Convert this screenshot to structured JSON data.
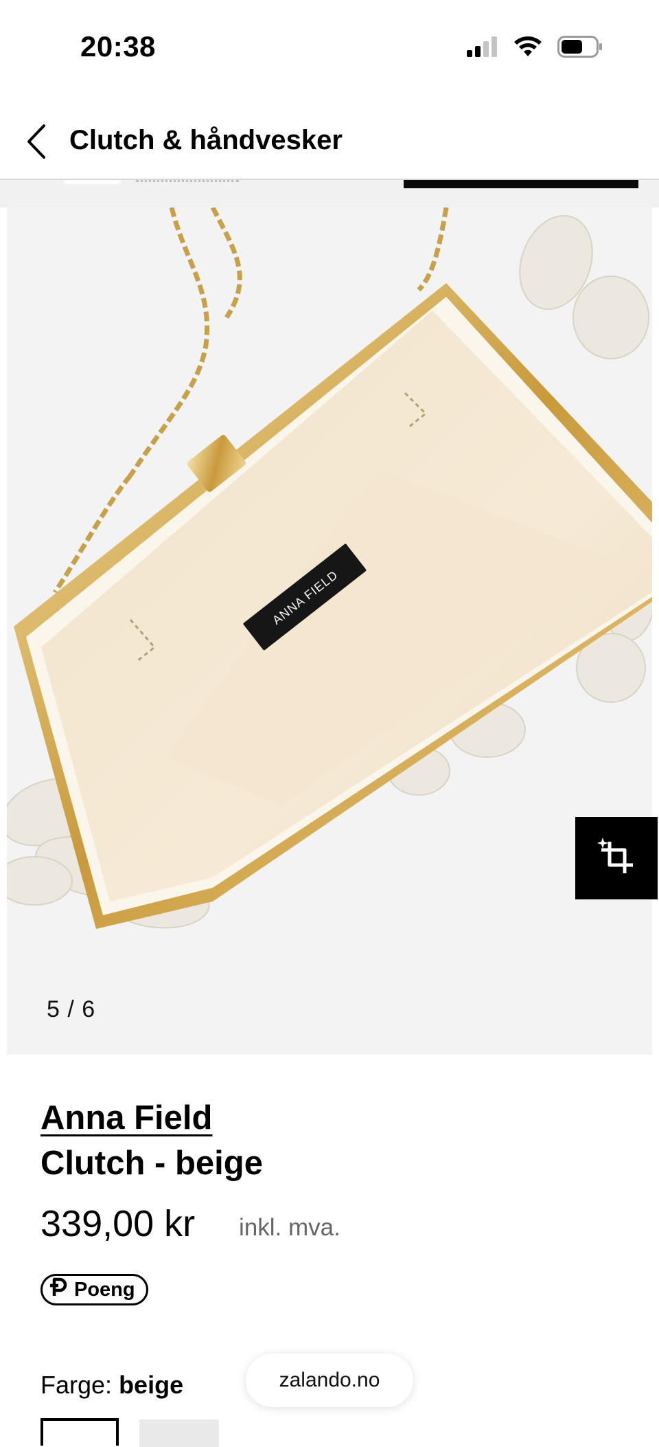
{
  "status_bar": {
    "time": "20:38",
    "icons": [
      "cellular-signal-icon",
      "wifi-icon",
      "battery-icon"
    ]
  },
  "header": {
    "back_icon": "chevron-left-icon",
    "title": "Clutch & håndvesker"
  },
  "gallery": {
    "counter": "5 / 6",
    "current_index": 5,
    "total": 6,
    "label_text": "ANNA FIELD",
    "crop_icon": "crop-sparkle-icon"
  },
  "product": {
    "brand": "Anna Field",
    "name": "Clutch - beige",
    "price": "339,00 kr",
    "vat": "inkl. mva.",
    "badge_label": "Poeng",
    "badge_icon": "points-p-icon",
    "color_label": "Farge:",
    "color_value": "beige"
  },
  "browser": {
    "url": "zalando.no"
  },
  "colors": {
    "text": "#000000",
    "muted": "#666666",
    "gallery_bg": "#f3f3f3",
    "accent_black": "#000000"
  }
}
